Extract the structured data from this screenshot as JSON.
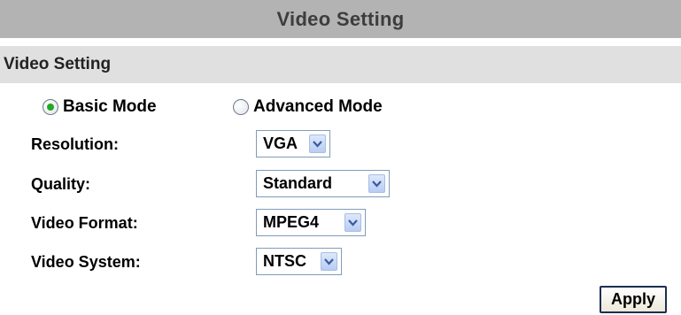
{
  "page_title": "Video Setting",
  "section": {
    "title": "Video Setting"
  },
  "mode": {
    "selected": "basic",
    "basic_label": "Basic Mode",
    "advanced_label": "Advanced Mode"
  },
  "fields": {
    "resolution": {
      "label": "Resolution:",
      "value": "VGA"
    },
    "quality": {
      "label": "Quality:",
      "value": "Standard"
    },
    "video_format": {
      "label": "Video Format:",
      "value": "MPEG4"
    },
    "video_system": {
      "label": "Video System:",
      "value": "NTSC"
    }
  },
  "apply_label": "Apply",
  "colors": {
    "title_bar": "#b3b3b3",
    "section_bar": "#e0e0e0",
    "radio_dot": "#22a822",
    "select_border": "#7f9db9"
  }
}
